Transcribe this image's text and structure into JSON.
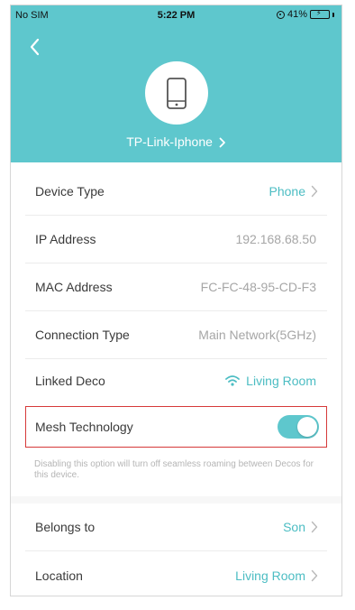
{
  "status_bar": {
    "carrier": "No SIM",
    "time": "5:22 PM",
    "battery": "41%"
  },
  "header": {
    "device_name": "TP-Link-Iphone",
    "accent_color": "#5ec7cd"
  },
  "details": {
    "device_type": {
      "label": "Device Type",
      "value": "Phone"
    },
    "ip_address": {
      "label": "IP Address",
      "value": "192.168.68.50"
    },
    "mac_address": {
      "label": "MAC Address",
      "value": "FC-FC-48-95-CD-F3"
    },
    "connection_type": {
      "label": "Connection Type",
      "value": "Main Network(5GHz)"
    },
    "linked_deco": {
      "label": "Linked Deco",
      "value": "Living Room"
    }
  },
  "mesh": {
    "label": "Mesh Technology",
    "enabled": true,
    "note": "Disabling this option will turn off seamless roaming between Decos for this device."
  },
  "extra": {
    "belongs_to": {
      "label": "Belongs to",
      "value": "Son"
    },
    "location": {
      "label": "Location",
      "value": "Living Room"
    }
  },
  "icons": [
    "back-icon",
    "phone-icon",
    "chevron-right-icon",
    "wifi-icon",
    "battery-icon",
    "lock-rotation-icon"
  ]
}
